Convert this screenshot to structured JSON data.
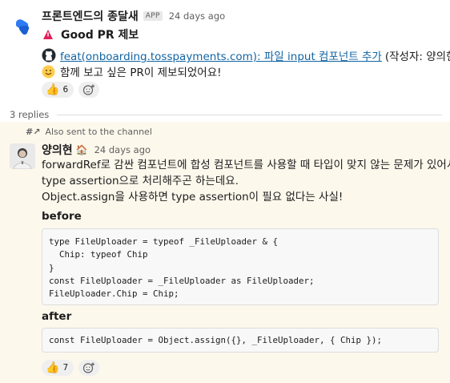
{
  "top_message": {
    "sender": "프론트엔드의 종달새",
    "badge": "APP",
    "timestamp": "24 days ago",
    "title": "Good PR 제보",
    "pr_link_text": "feat(onboarding.tosspayments.com): 파일 input 컴포넌트 추가",
    "pr_author": "(작성자: 양의현)",
    "message": "함께 보고 싶은 PR이 제보되었어요!",
    "reaction_count": "6",
    "icons": [
      "bot-logo-icon",
      "alert-icon",
      "github-icon",
      "smile-emoji-icon",
      "thumbs-up-icon",
      "add-reaction-icon"
    ]
  },
  "replies": {
    "count_label": "3 replies"
  },
  "reply": {
    "also_sent": "Also sent to the channel",
    "sender": "양의현",
    "status_emoji": "🏠",
    "timestamp": "24 days ago",
    "body_lines": [
      "forwardRef로 감싼 컴포넌트에 합성 컴포넌트를 사용할 때 타입이 맞지 않는 문제가 있어서",
      "type assertion으로 처리해주곤 하는데요.",
      "Object.assign을 사용하면 type assertion이 필요 없다는 사실!"
    ],
    "before_label": "before",
    "before_code": [
      "type FileUploader = typeof _FileUploader & {",
      "  Chip: typeof Chip",
      "}",
      "const FileUploader = _FileUploader as FileUploader;",
      "FileUploader.Chip = Chip;"
    ],
    "after_label": "after",
    "after_code": "const FileUploader = Object.assign({}, _FileUploader, { Chip });",
    "reaction_count": "7"
  },
  "colors": {
    "link": "#1264a3",
    "highlight_bg": "#fdf8ec",
    "muted_text": "#616061",
    "code_bg": "#f8f8f8"
  }
}
